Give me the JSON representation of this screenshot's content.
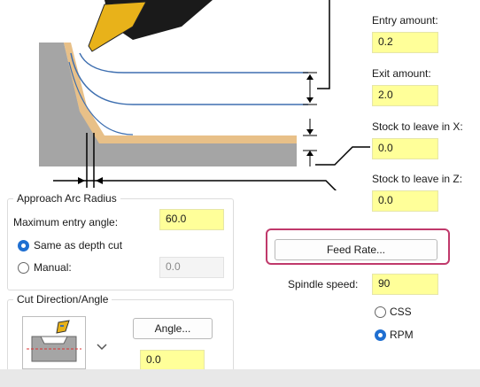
{
  "colors": {
    "field_fill": "#ffff99",
    "highlight_border": "#c0396b",
    "radio_selected": "#1f6fd1",
    "toolpath_blue": "#3e6fb0",
    "stock_orange": "#e8c088",
    "part_gray": "#a5a5a5",
    "tool_yellow": "#e8b21a"
  },
  "right_panel": {
    "entry_amount": {
      "label": "Entry amount:",
      "value": "0.2"
    },
    "exit_amount": {
      "label": "Exit amount:",
      "value": "2.0"
    },
    "stock_x": {
      "label": "Stock to leave in X:",
      "value": "0.0"
    },
    "stock_z": {
      "label": "Stock to leave in Z:",
      "value": "0.0"
    },
    "feed_rate_button": "Feed Rate...",
    "spindle_speed": {
      "label": "Spindle speed:",
      "value": "90"
    },
    "css_label": "CSS",
    "rpm_label": "RPM",
    "rpm_selected": true
  },
  "approach_group": {
    "title": "Approach Arc Radius",
    "max_entry_angle": {
      "label": "Maximum entry angle:",
      "value": "60.0"
    },
    "same_as_depth_label": "Same as depth cut",
    "same_as_depth_selected": true,
    "manual_label": "Manual:",
    "manual_value": "0.0"
  },
  "cut_direction_group": {
    "title": "Cut Direction/Angle",
    "angle_button": "Angle...",
    "angle_value": "0.0",
    "dropdown_icon": "chevron-down-icon"
  }
}
